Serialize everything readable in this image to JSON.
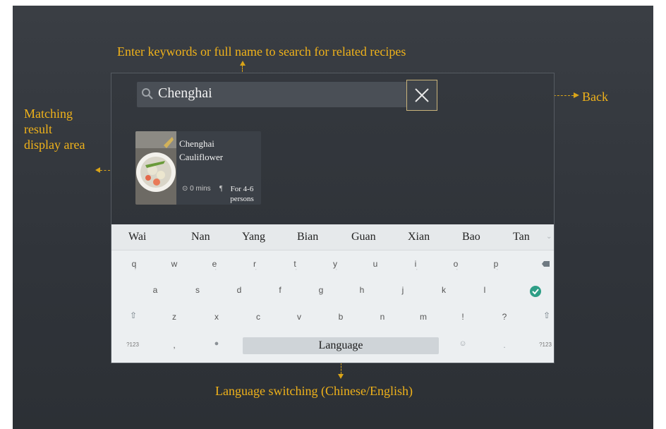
{
  "annotations": {
    "top": "Enter keywords or full name to search for related recipes",
    "left": [
      "Matching",
      "result",
      "display area"
    ],
    "back": "Back",
    "bottom": "Language switching (Chinese/English)"
  },
  "search": {
    "value": "Chenghai",
    "icon": "search-icon",
    "close_icon": "close-icon"
  },
  "result_card": {
    "title_line1": "Chenghai",
    "title_line2": "Cauliflower",
    "time": "0 mins",
    "persons_line1": "For 4-6",
    "persons_line2": "persons"
  },
  "keyboard": {
    "suggestions": [
      "Wai",
      "Nan",
      "Yang",
      "Bian",
      "Guan",
      "Xian",
      "Bao",
      "Tan"
    ],
    "row1": [
      "q",
      "w",
      "e",
      "r",
      "t",
      "y",
      "u",
      "i",
      "o",
      "p"
    ],
    "row2": [
      "a",
      "s",
      "d",
      "f",
      "g",
      "h",
      "j",
      "k",
      "l"
    ],
    "row3": [
      "z",
      "x",
      "c",
      "v",
      "b",
      "n",
      "m",
      "!",
      "?"
    ],
    "symbols_label": "?123",
    "comma": ",",
    "period": ".",
    "space_label": "Language",
    "colors": {
      "enter": "#2e9e86",
      "annotation": "#f0b21a"
    }
  }
}
